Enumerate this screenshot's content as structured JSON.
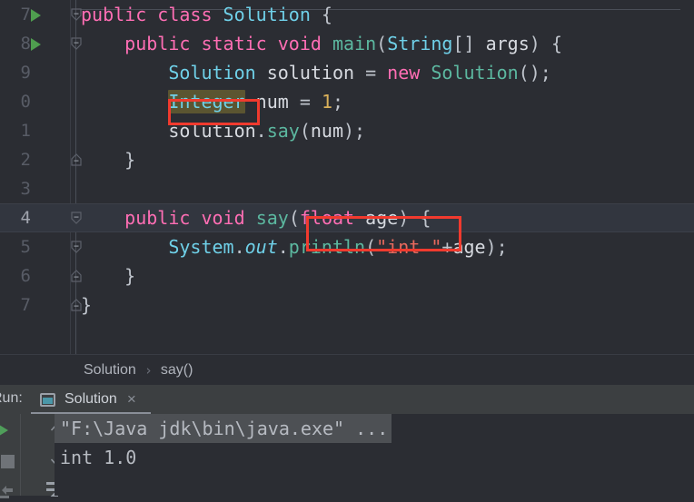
{
  "app": {
    "theme_bg": "#2b2d33",
    "accent_red": "#f03a2e",
    "keyword_color": "#ff6eb4",
    "class_color": "#6fd0e8",
    "method_color": "#5cb8a0",
    "string_color": "#e8695d",
    "number_color": "#d9b05a"
  },
  "editor": {
    "lines": [
      {
        "num": "7",
        "code": "public class Solution {",
        "runnable": true,
        "fold": "down",
        "current": false
      },
      {
        "num": "8",
        "code": "    public static void main(String[] args) {",
        "runnable": true,
        "fold": "down",
        "current": false
      },
      {
        "num": "9",
        "code": "        Solution solution = new Solution();",
        "runnable": false,
        "fold": "none",
        "current": false
      },
      {
        "num": "0",
        "code": "        Integer num = 1;",
        "runnable": false,
        "fold": "none",
        "current": false
      },
      {
        "num": "1",
        "code": "        solution.say(num);",
        "runnable": false,
        "fold": "none",
        "current": false
      },
      {
        "num": "2",
        "code": "    }",
        "runnable": false,
        "fold": "up",
        "current": false
      },
      {
        "num": "3",
        "code": "",
        "runnable": false,
        "fold": "none",
        "current": false
      },
      {
        "num": "4",
        "code": "    public void say(float age) {",
        "runnable": false,
        "fold": "down",
        "current": true
      },
      {
        "num": "5",
        "code": "        System.out.println(\"int \"+age);",
        "runnable": false,
        "fold": "down",
        "current": false
      },
      {
        "num": "6",
        "code": "    }",
        "runnable": false,
        "fold": "up",
        "current": false
      },
      {
        "num": "7",
        "code": "}",
        "runnable": false,
        "fold": "up",
        "current": false
      }
    ],
    "highlighted_identifier": "Integer",
    "annotations": [
      {
        "label": "integer-type-annotation",
        "target": "Integer"
      },
      {
        "label": "float-param-annotation",
        "target": "(float age) {"
      }
    ]
  },
  "breadcrumb": {
    "class": "Solution",
    "separator": "›",
    "method": "say()"
  },
  "run_window": {
    "label": "Run:",
    "tab_name": "Solution",
    "close_glyph": "×",
    "console": [
      {
        "text": "\"F:\\Java jdk\\bin\\java.exe\" ...",
        "folded": true
      },
      {
        "text": "int 1.0",
        "folded": false
      }
    ],
    "toolbar": {
      "rerun_title": "Rerun",
      "stop_title": "Stop",
      "up_title": "Up",
      "down_title": "Down",
      "wrap_title": "Soft-Wrap"
    }
  },
  "tokens": {
    "l7": [
      {
        "t": "public ",
        "c": "kw"
      },
      {
        "t": "class ",
        "c": "kw"
      },
      {
        "t": "Solution",
        "c": "cls"
      },
      {
        "t": " {",
        "c": "punct"
      }
    ],
    "l8": [
      {
        "t": "    ",
        "c": "plain"
      },
      {
        "t": "public ",
        "c": "kw"
      },
      {
        "t": "static ",
        "c": "kw"
      },
      {
        "t": "void ",
        "c": "kw"
      },
      {
        "t": "main",
        "c": "mth"
      },
      {
        "t": "(",
        "c": "punct"
      },
      {
        "t": "String",
        "c": "cls"
      },
      {
        "t": "[] ",
        "c": "punct"
      },
      {
        "t": "args",
        "c": "plain"
      },
      {
        "t": ") {",
        "c": "punct"
      }
    ],
    "l9": [
      {
        "t": "        ",
        "c": "plain"
      },
      {
        "t": "Solution",
        "c": "cls"
      },
      {
        "t": " solution ",
        "c": "plain"
      },
      {
        "t": "= ",
        "c": "punct"
      },
      {
        "t": "new ",
        "c": "kw"
      },
      {
        "t": "Solution",
        "c": "mth"
      },
      {
        "t": "();",
        "c": "punct"
      }
    ],
    "l0": [
      {
        "t": "        ",
        "c": "plain"
      },
      {
        "t": "Integer",
        "c": "cls hl"
      },
      {
        "t": " num ",
        "c": "plain"
      },
      {
        "t": "= ",
        "c": "punct"
      },
      {
        "t": "1",
        "c": "num"
      },
      {
        "t": ";",
        "c": "punct"
      }
    ],
    "l1": [
      {
        "t": "        ",
        "c": "plain"
      },
      {
        "t": "solution",
        "c": "plain"
      },
      {
        "t": ".",
        "c": "punct"
      },
      {
        "t": "say",
        "c": "mth"
      },
      {
        "t": "(",
        "c": "punct"
      },
      {
        "t": "num",
        "c": "plain"
      },
      {
        "t": ");",
        "c": "punct"
      }
    ],
    "l2": [
      {
        "t": "    }",
        "c": "punct"
      }
    ],
    "l3": [],
    "l4": [
      {
        "t": "    ",
        "c": "plain"
      },
      {
        "t": "public ",
        "c": "kw"
      },
      {
        "t": "void ",
        "c": "kw"
      },
      {
        "t": "say",
        "c": "mth"
      },
      {
        "t": "(",
        "c": "punct"
      },
      {
        "t": "float ",
        "c": "kw"
      },
      {
        "t": "age",
        "c": "plain"
      },
      {
        "t": ") {",
        "c": "punct"
      }
    ],
    "l5": [
      {
        "t": "        ",
        "c": "plain"
      },
      {
        "t": "System",
        "c": "cls"
      },
      {
        "t": ".",
        "c": "punct"
      },
      {
        "t": "out",
        "c": "fld"
      },
      {
        "t": ".",
        "c": "punct"
      },
      {
        "t": "println",
        "c": "mth"
      },
      {
        "t": "(",
        "c": "punct"
      },
      {
        "t": "\"int \"",
        "c": "str"
      },
      {
        "t": "+",
        "c": "punct"
      },
      {
        "t": "age",
        "c": "plain"
      },
      {
        "t": ");",
        "c": "punct"
      }
    ],
    "l6": [
      {
        "t": "    }",
        "c": "punct"
      }
    ],
    "l7b": [
      {
        "t": "}",
        "c": "punct"
      }
    ]
  }
}
